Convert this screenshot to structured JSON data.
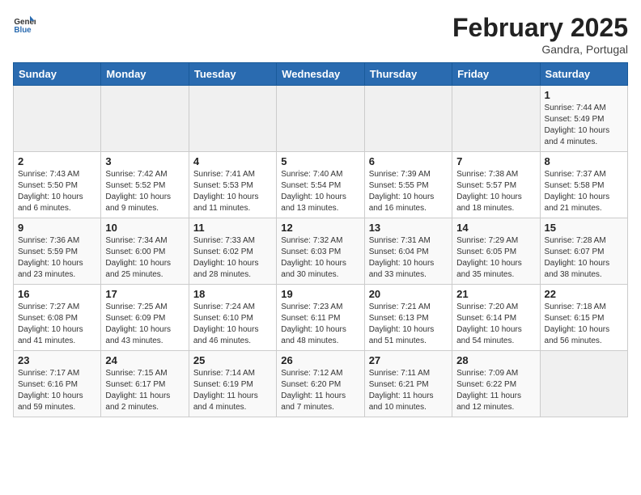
{
  "header": {
    "logo_general": "General",
    "logo_blue": "Blue",
    "month_year": "February 2025",
    "location": "Gandra, Portugal"
  },
  "weekdays": [
    "Sunday",
    "Monday",
    "Tuesday",
    "Wednesday",
    "Thursday",
    "Friday",
    "Saturday"
  ],
  "weeks": [
    [
      {
        "day": "",
        "info": ""
      },
      {
        "day": "",
        "info": ""
      },
      {
        "day": "",
        "info": ""
      },
      {
        "day": "",
        "info": ""
      },
      {
        "day": "",
        "info": ""
      },
      {
        "day": "",
        "info": ""
      },
      {
        "day": "1",
        "info": "Sunrise: 7:44 AM\nSunset: 5:49 PM\nDaylight: 10 hours and 4 minutes."
      }
    ],
    [
      {
        "day": "2",
        "info": "Sunrise: 7:43 AM\nSunset: 5:50 PM\nDaylight: 10 hours and 6 minutes."
      },
      {
        "day": "3",
        "info": "Sunrise: 7:42 AM\nSunset: 5:52 PM\nDaylight: 10 hours and 9 minutes."
      },
      {
        "day": "4",
        "info": "Sunrise: 7:41 AM\nSunset: 5:53 PM\nDaylight: 10 hours and 11 minutes."
      },
      {
        "day": "5",
        "info": "Sunrise: 7:40 AM\nSunset: 5:54 PM\nDaylight: 10 hours and 13 minutes."
      },
      {
        "day": "6",
        "info": "Sunrise: 7:39 AM\nSunset: 5:55 PM\nDaylight: 10 hours and 16 minutes."
      },
      {
        "day": "7",
        "info": "Sunrise: 7:38 AM\nSunset: 5:57 PM\nDaylight: 10 hours and 18 minutes."
      },
      {
        "day": "8",
        "info": "Sunrise: 7:37 AM\nSunset: 5:58 PM\nDaylight: 10 hours and 21 minutes."
      }
    ],
    [
      {
        "day": "9",
        "info": "Sunrise: 7:36 AM\nSunset: 5:59 PM\nDaylight: 10 hours and 23 minutes."
      },
      {
        "day": "10",
        "info": "Sunrise: 7:34 AM\nSunset: 6:00 PM\nDaylight: 10 hours and 25 minutes."
      },
      {
        "day": "11",
        "info": "Sunrise: 7:33 AM\nSunset: 6:02 PM\nDaylight: 10 hours and 28 minutes."
      },
      {
        "day": "12",
        "info": "Sunrise: 7:32 AM\nSunset: 6:03 PM\nDaylight: 10 hours and 30 minutes."
      },
      {
        "day": "13",
        "info": "Sunrise: 7:31 AM\nSunset: 6:04 PM\nDaylight: 10 hours and 33 minutes."
      },
      {
        "day": "14",
        "info": "Sunrise: 7:29 AM\nSunset: 6:05 PM\nDaylight: 10 hours and 35 minutes."
      },
      {
        "day": "15",
        "info": "Sunrise: 7:28 AM\nSunset: 6:07 PM\nDaylight: 10 hours and 38 minutes."
      }
    ],
    [
      {
        "day": "16",
        "info": "Sunrise: 7:27 AM\nSunset: 6:08 PM\nDaylight: 10 hours and 41 minutes."
      },
      {
        "day": "17",
        "info": "Sunrise: 7:25 AM\nSunset: 6:09 PM\nDaylight: 10 hours and 43 minutes."
      },
      {
        "day": "18",
        "info": "Sunrise: 7:24 AM\nSunset: 6:10 PM\nDaylight: 10 hours and 46 minutes."
      },
      {
        "day": "19",
        "info": "Sunrise: 7:23 AM\nSunset: 6:11 PM\nDaylight: 10 hours and 48 minutes."
      },
      {
        "day": "20",
        "info": "Sunrise: 7:21 AM\nSunset: 6:13 PM\nDaylight: 10 hours and 51 minutes."
      },
      {
        "day": "21",
        "info": "Sunrise: 7:20 AM\nSunset: 6:14 PM\nDaylight: 10 hours and 54 minutes."
      },
      {
        "day": "22",
        "info": "Sunrise: 7:18 AM\nSunset: 6:15 PM\nDaylight: 10 hours and 56 minutes."
      }
    ],
    [
      {
        "day": "23",
        "info": "Sunrise: 7:17 AM\nSunset: 6:16 PM\nDaylight: 10 hours and 59 minutes."
      },
      {
        "day": "24",
        "info": "Sunrise: 7:15 AM\nSunset: 6:17 PM\nDaylight: 11 hours and 2 minutes."
      },
      {
        "day": "25",
        "info": "Sunrise: 7:14 AM\nSunset: 6:19 PM\nDaylight: 11 hours and 4 minutes."
      },
      {
        "day": "26",
        "info": "Sunrise: 7:12 AM\nSunset: 6:20 PM\nDaylight: 11 hours and 7 minutes."
      },
      {
        "day": "27",
        "info": "Sunrise: 7:11 AM\nSunset: 6:21 PM\nDaylight: 11 hours and 10 minutes."
      },
      {
        "day": "28",
        "info": "Sunrise: 7:09 AM\nSunset: 6:22 PM\nDaylight: 11 hours and 12 minutes."
      },
      {
        "day": "",
        "info": ""
      }
    ]
  ]
}
